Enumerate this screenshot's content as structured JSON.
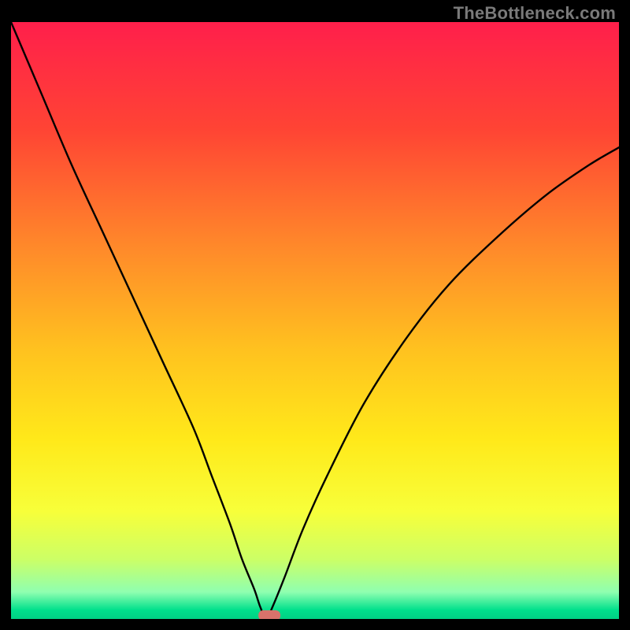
{
  "watermark": "TheBottleneck.com",
  "chart_data": {
    "type": "line",
    "title": "",
    "xlabel": "",
    "ylabel": "",
    "xlim": [
      0,
      100
    ],
    "ylim": [
      0,
      100
    ],
    "series": [
      {
        "name": "curve",
        "x": [
          0,
          5,
          10,
          15,
          20,
          25,
          30,
          33,
          36,
          38,
          40,
          41,
          42,
          43,
          45,
          48,
          52,
          58,
          65,
          72,
          80,
          88,
          95,
          100
        ],
        "y": [
          100,
          88,
          76,
          65,
          54,
          43,
          32,
          24,
          16,
          10,
          5,
          2,
          0,
          2,
          7,
          15,
          24,
          36,
          47,
          56,
          64,
          71,
          76,
          79
        ]
      }
    ],
    "marker": {
      "x": 42.5,
      "y": 0.6,
      "color": "#d9726b"
    },
    "gradient_stops": [
      {
        "offset": 0.0,
        "color": "#ff1f4b"
      },
      {
        "offset": 0.18,
        "color": "#ff4434"
      },
      {
        "offset": 0.38,
        "color": "#ff8a2a"
      },
      {
        "offset": 0.55,
        "color": "#ffc21f"
      },
      {
        "offset": 0.7,
        "color": "#ffe91a"
      },
      {
        "offset": 0.82,
        "color": "#f7ff3a"
      },
      {
        "offset": 0.9,
        "color": "#ccff66"
      },
      {
        "offset": 0.955,
        "color": "#8fffb0"
      },
      {
        "offset": 0.985,
        "color": "#00e08c"
      },
      {
        "offset": 1.0,
        "color": "#00d084"
      }
    ]
  }
}
